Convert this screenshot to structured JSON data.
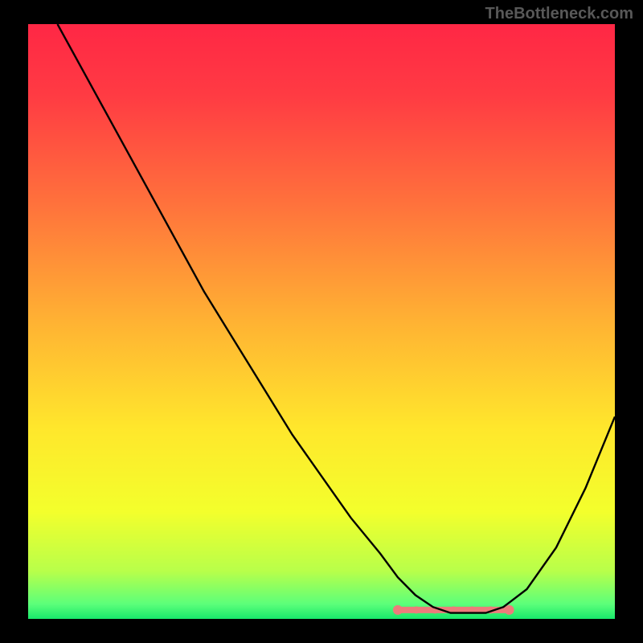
{
  "watermark": "TheBottleneck.com",
  "chart_data": {
    "type": "line",
    "title": "",
    "xlabel": "",
    "ylabel": "",
    "xlim": [
      0,
      100
    ],
    "ylim": [
      0,
      100
    ],
    "series": [
      {
        "name": "bottleneck-curve",
        "x": [
          5,
          10,
          15,
          20,
          25,
          30,
          35,
          40,
          45,
          50,
          55,
          60,
          63,
          66,
          69,
          72,
          75,
          78,
          81,
          85,
          90,
          95,
          100
        ],
        "values": [
          100,
          91,
          82,
          73,
          64,
          55,
          47,
          39,
          31,
          24,
          17,
          11,
          7,
          4,
          2,
          1,
          1,
          1,
          2,
          5,
          12,
          22,
          34
        ]
      }
    ],
    "highlight_region": {
      "name": "optimal-range",
      "x_start": 63,
      "x_end": 82,
      "y": 1.5,
      "color": "#ed7b7b"
    },
    "background_gradient": {
      "stops": [
        {
          "offset": 0.0,
          "color": "#ff2745"
        },
        {
          "offset": 0.12,
          "color": "#ff3b43"
        },
        {
          "offset": 0.3,
          "color": "#ff713c"
        },
        {
          "offset": 0.5,
          "color": "#ffb233"
        },
        {
          "offset": 0.68,
          "color": "#ffe72c"
        },
        {
          "offset": 0.82,
          "color": "#f3ff2c"
        },
        {
          "offset": 0.92,
          "color": "#b8ff4a"
        },
        {
          "offset": 0.975,
          "color": "#5cff7a"
        },
        {
          "offset": 1.0,
          "color": "#18e86b"
        }
      ]
    }
  }
}
